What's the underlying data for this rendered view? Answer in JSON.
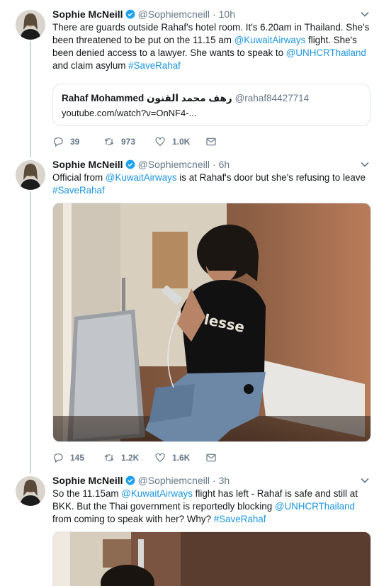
{
  "colors": {
    "link": "#1b95e0",
    "text": "#14171a",
    "muted": "#657786",
    "verified": "#1da1f2",
    "thread": "#ccd6dd"
  },
  "tweets": [
    {
      "name": "Sophie McNeill",
      "handle": "@Sophiemcneill",
      "separator": "·",
      "time": "10h",
      "text": [
        {
          "t": "There are guards outside Rahaf's hotel room. It's 6.20am in Thailand. She's been threatened to be put on the 11.15 am ",
          "link": false
        },
        {
          "t": "@KuwaitAirways",
          "link": true
        },
        {
          "t": " flight. She's been denied access to a lawyer. She wants to speak to ",
          "link": false
        },
        {
          "t": "@UNHCRThailand",
          "link": true
        },
        {
          "t": " and claim asylum ",
          "link": false
        },
        {
          "t": "#SaveRahaf",
          "link": true
        }
      ],
      "quote": {
        "name": "Rahaf Mohammed رهف محمد القنون",
        "handle": "@rahaf84427714",
        "url": "youtube.com/watch?v=OnNF4-..."
      },
      "replies": "39",
      "retweets": "973",
      "likes": "1.0K"
    },
    {
      "name": "Sophie McNeill",
      "handle": "@Sophiemcneill",
      "separator": "·",
      "time": "6h",
      "text": [
        {
          "t": "Official from ",
          "link": false
        },
        {
          "t": "@KuwaitAirways",
          "link": true
        },
        {
          "t": " is at Rahaf's door but she's refusing to leave ",
          "link": false
        },
        {
          "t": "#SaveRahaf",
          "link": true
        }
      ],
      "photo": "photo-hotel-room",
      "replies": "145",
      "retweets": "1.2K",
      "likes": "1.6K"
    },
    {
      "name": "Sophie McNeill",
      "handle": "@Sophiemcneill",
      "separator": "·",
      "time": "3h",
      "text": [
        {
          "t": "So the 11.15am ",
          "link": false
        },
        {
          "t": "@KuwaitAirways",
          "link": true
        },
        {
          "t": " flight has left - Rahaf is safe and still at BKK. But the Thai government is reportedly blocking ",
          "link": false
        },
        {
          "t": "@UNHCRThailand",
          "link": true
        },
        {
          "t": " from coming to speak with her? Why? ",
          "link": false
        },
        {
          "t": "#SaveRahaf",
          "link": true
        }
      ],
      "photo": "photo-hotel-room-partial"
    }
  ]
}
